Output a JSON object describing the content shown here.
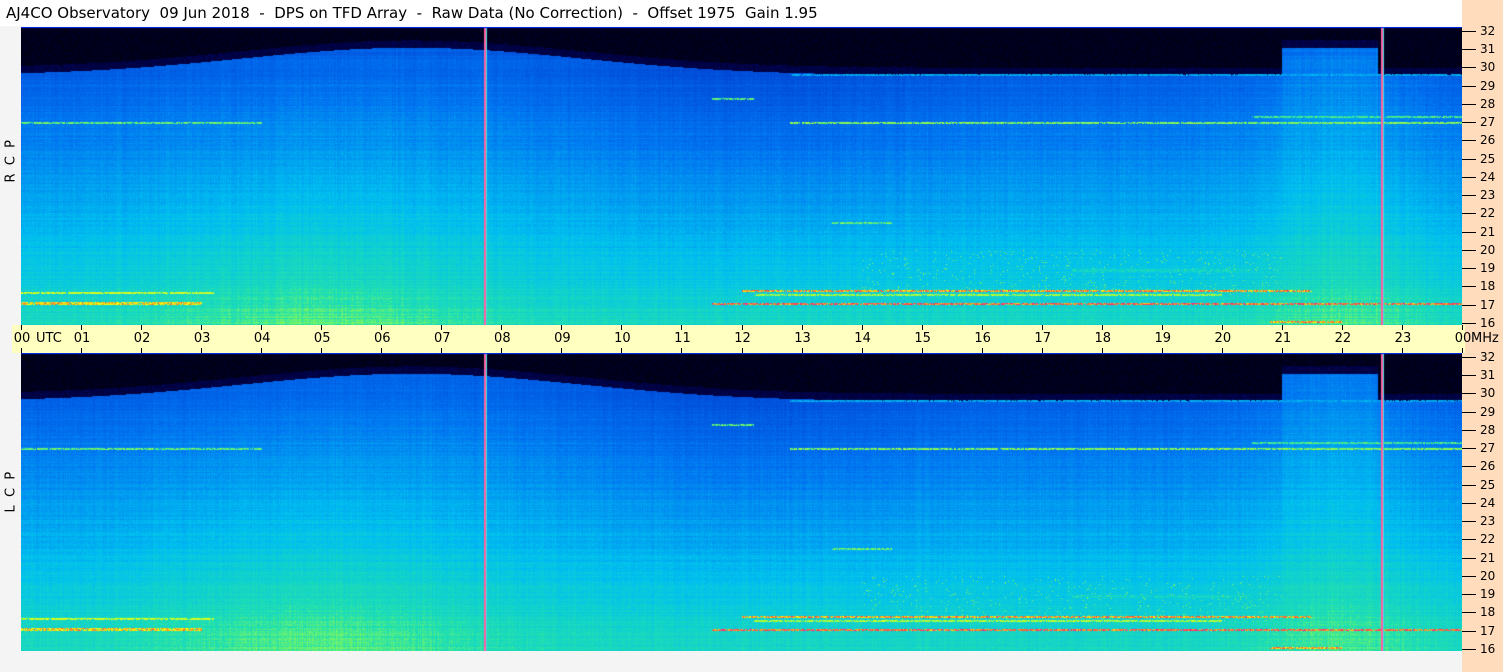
{
  "title": "AJ4CO Observatory  09 Jun 2018  -  DPS on TFD Array  -  Raw Data (No Correction)  -  Offset 1975  Gain 1.95",
  "chart_data": {
    "type": "heatmap",
    "title": "AJ4CO Observatory  09 Jun 2018  -  DPS on TFD Array  -  Raw Data (No Correction)  -  Offset 1975  Gain 1.95",
    "xlabel": "UTC",
    "ylabel": "MHz",
    "x_unit_label": "UTC",
    "y_unit_label": "MHz",
    "xlim_hours": [
      0,
      24
    ],
    "ylim_mhz": [
      16,
      32
    ],
    "x_ticks": [
      "00",
      "01",
      "02",
      "03",
      "04",
      "05",
      "06",
      "07",
      "08",
      "09",
      "10",
      "11",
      "12",
      "13",
      "14",
      "15",
      "16",
      "17",
      "18",
      "19",
      "20",
      "21",
      "22",
      "23",
      "00"
    ],
    "y_ticks": [
      "16",
      "17",
      "18",
      "19",
      "20",
      "21",
      "22",
      "23",
      "24",
      "25",
      "26",
      "27",
      "28",
      "29",
      "30",
      "31",
      "32"
    ],
    "panels": [
      {
        "label": "R  C  P",
        "polarization": "RCP"
      },
      {
        "label": "L  C  P",
        "polarization": "LCP"
      }
    ],
    "colormap": [
      "#000000",
      "#000040",
      "#0028c0",
      "#0070f0",
      "#00c0f0",
      "#20e0b0",
      "#a0ff40",
      "#ffff00",
      "#ff4040",
      "#ff00ff"
    ],
    "markers_utc_hours": [
      7.72,
      22.67
    ],
    "interference_bands": [
      {
        "freq": 17.05,
        "start": 11.5,
        "end": 24,
        "level": 0.97
      },
      {
        "freq": 17.8,
        "start": 12,
        "end": 21.5,
        "level": 0.95
      },
      {
        "freq": 17.55,
        "start": 12.2,
        "end": 20,
        "level": 0.85
      },
      {
        "freq": 17.1,
        "start": 0,
        "end": 3,
        "level": 0.93
      },
      {
        "freq": 17.65,
        "start": 0,
        "end": 3.2,
        "level": 0.88
      },
      {
        "freq": 16.1,
        "start": 20.8,
        "end": 22,
        "level": 0.95
      },
      {
        "freq": 27.0,
        "start": 0,
        "end": 4,
        "level": 0.8
      },
      {
        "freq": 27.0,
        "start": 12.8,
        "end": 24,
        "level": 0.82
      },
      {
        "freq": 27.3,
        "start": 20.5,
        "end": 24,
        "level": 0.78
      },
      {
        "freq": 21.5,
        "start": 13.5,
        "end": 14.5,
        "level": 0.8
      },
      {
        "freq": 29.6,
        "start": 12.8,
        "end": 24,
        "level": 0.6
      },
      {
        "freq": 28.3,
        "start": 11.5,
        "end": 12.2,
        "level": 0.8
      },
      {
        "freq": 21.0,
        "start": 0,
        "end": 24,
        "level": 0.62
      },
      {
        "freq": 18.9,
        "start": 17.5,
        "end": 20.5,
        "level": 0.72
      }
    ]
  }
}
